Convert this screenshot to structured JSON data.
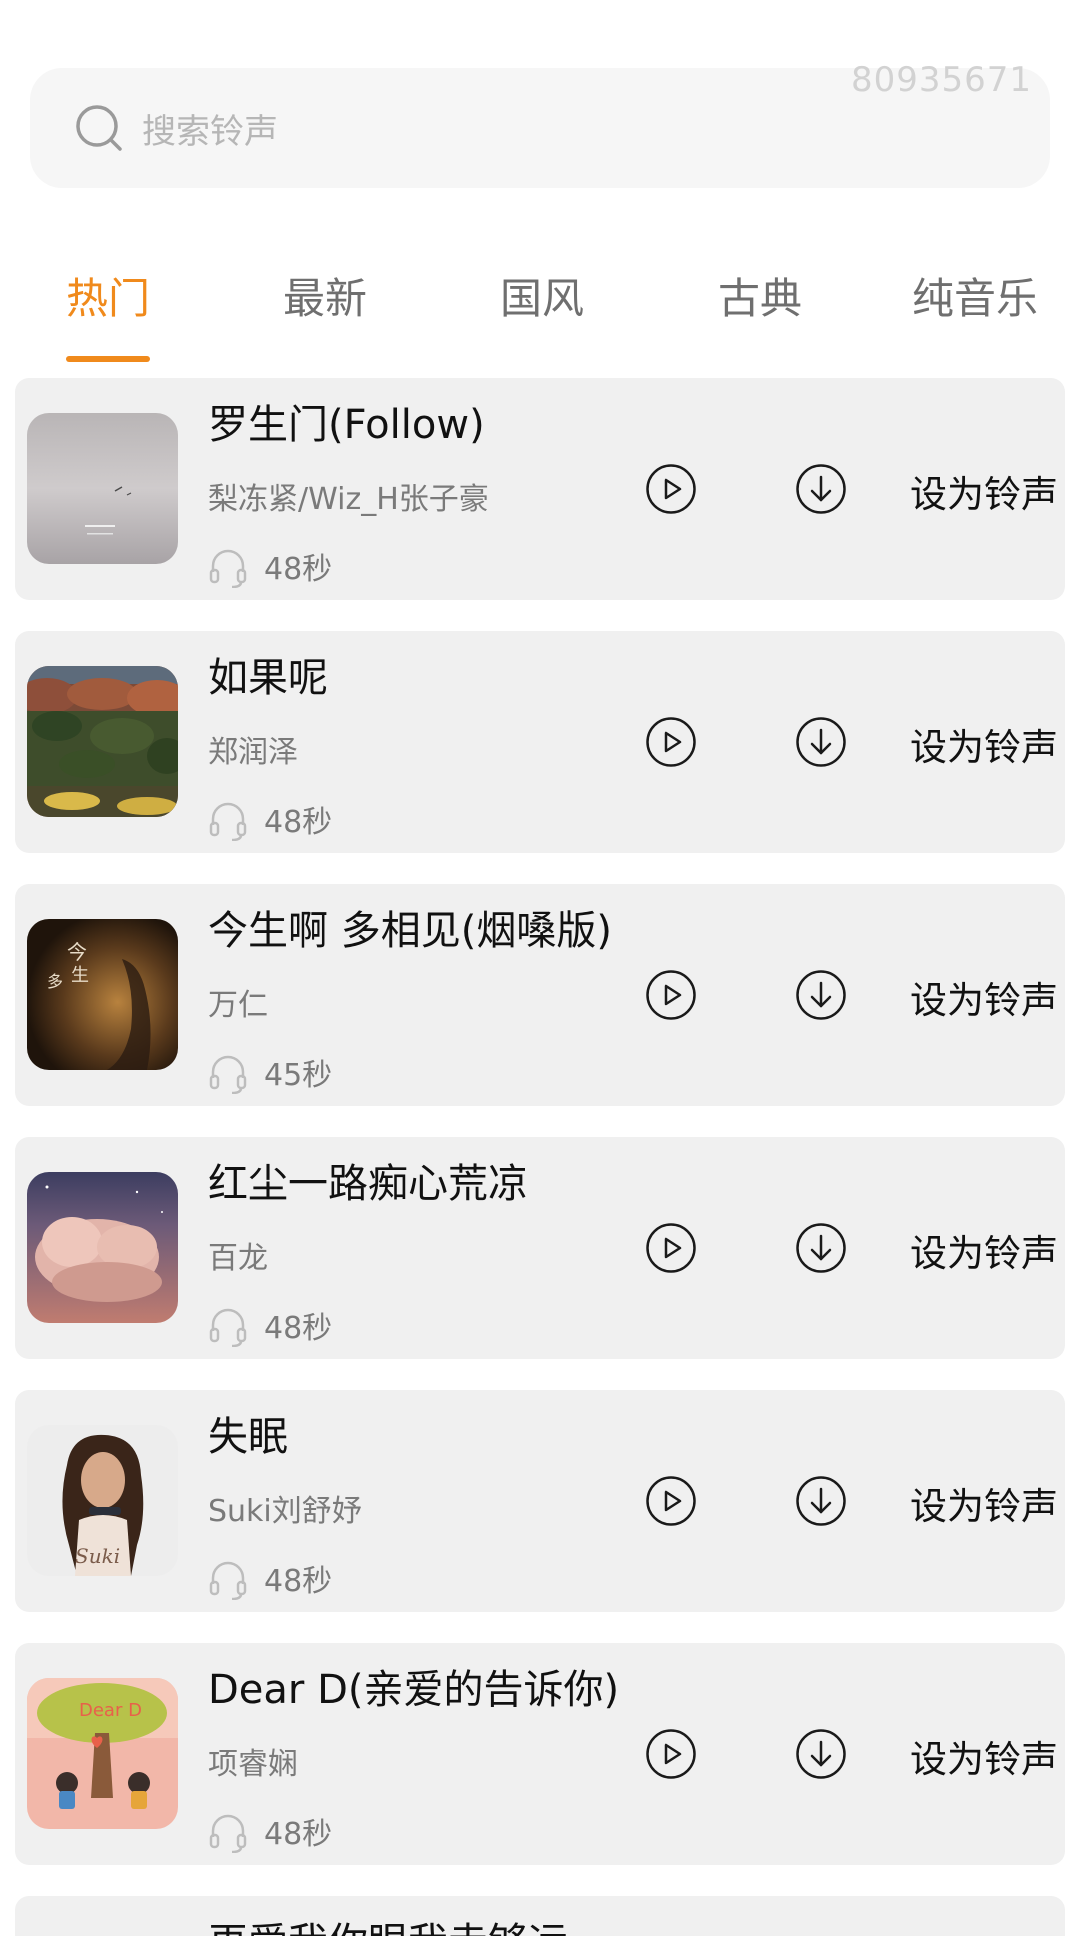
{
  "watermark": "80935671",
  "search": {
    "placeholder": "搜索铃声",
    "icon": "search-icon"
  },
  "tabs": [
    {
      "label": "热门",
      "active": true
    },
    {
      "label": "最新",
      "active": false
    },
    {
      "label": "国风",
      "active": false
    },
    {
      "label": "古典",
      "active": false
    },
    {
      "label": "纯音乐",
      "active": false
    }
  ],
  "accent_color": "#f08a1c",
  "card_background": "#f0f0f0",
  "songs": [
    {
      "title": "罗生门(Follow)",
      "artist": "梨冻紧/Wiz_H张子豪",
      "duration": "48秒",
      "action": "设为铃声",
      "cover": "cover-foggy-gray"
    },
    {
      "title": "如果呢",
      "artist": "郑润泽",
      "duration": "48秒",
      "action": "设为铃声",
      "cover": "cover-autumn-forest"
    },
    {
      "title": "今生啊 多相见(烟嗓版)",
      "artist": "万仁",
      "duration": "45秒",
      "action": "设为铃声",
      "cover": "cover-dark-hand"
    },
    {
      "title": "红尘一路痴心荒凉",
      "artist": "百龙",
      "duration": "48秒",
      "action": "设为铃声",
      "cover": "cover-pink-cloud"
    },
    {
      "title": "失眠",
      "artist": "Suki刘舒妤",
      "duration": "48秒",
      "action": "设为铃声",
      "cover": "cover-portrait"
    },
    {
      "title": "Dear D(亲爱的告诉你)",
      "artist": "项睿娴",
      "duration": "48秒",
      "action": "设为铃声",
      "cover": "cover-cartoon-tree"
    },
    {
      "title": "再爱我你眼我走够远",
      "artist": "",
      "duration": "",
      "action": "",
      "cover": ""
    }
  ]
}
